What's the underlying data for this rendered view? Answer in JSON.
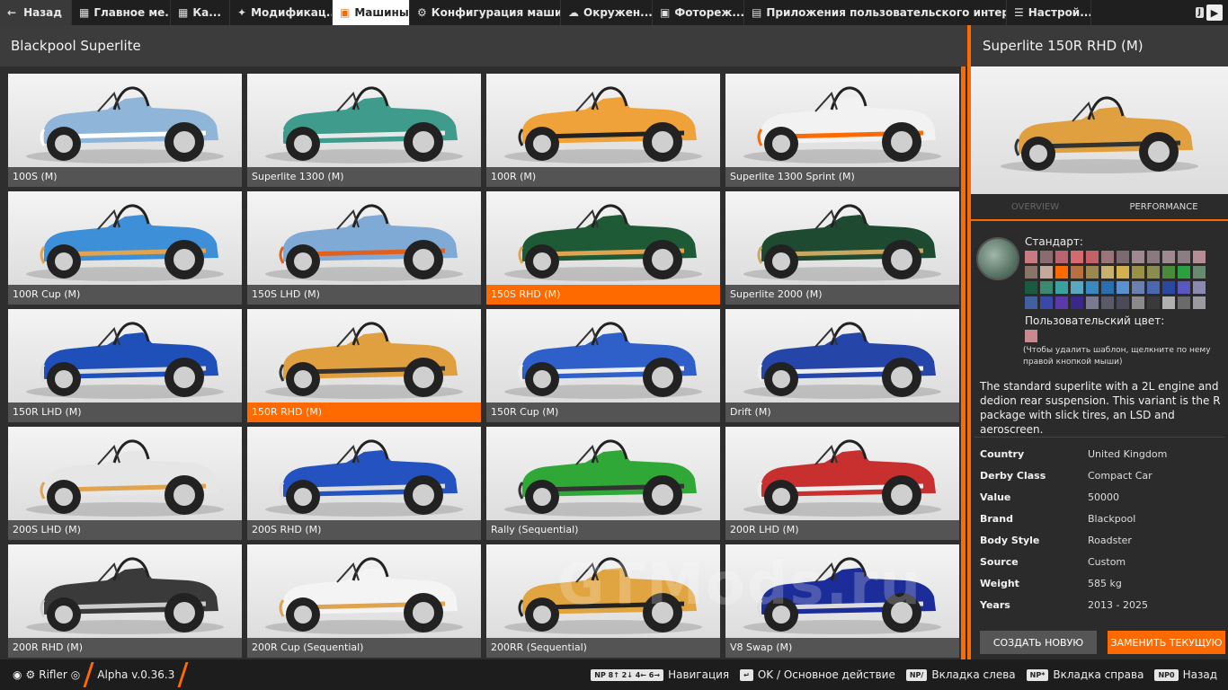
{
  "colors": {
    "accent": "#ff6a00"
  },
  "topbar": {
    "back_label": "Назад",
    "tabs": [
      {
        "label": "Главное ме...",
        "icon": "grid-icon"
      },
      {
        "label": "Ка...",
        "icon": "map-icon"
      },
      {
        "label": "Модификац...",
        "icon": "puzzle-icon"
      },
      {
        "label": "Машины",
        "icon": "car-icon"
      },
      {
        "label": "Конфигурация маши...",
        "icon": "engine-icon"
      },
      {
        "label": "Окружен...",
        "icon": "weather-icon"
      },
      {
        "label": "Фотореж...",
        "icon": "camera-icon"
      },
      {
        "label": "Приложения пользовательского интерфе...",
        "icon": "window-icon"
      },
      {
        "label": "Настрой...",
        "icon": "sliders-icon"
      }
    ],
    "key_hint": "J"
  },
  "header": {
    "title": "Blackpool Superlite"
  },
  "cars": [
    {
      "name": "100S (M)",
      "body": "#8fb6d8",
      "accent": "#ffffff"
    },
    {
      "name": "Superlite 1300 (M)",
      "body": "#3f9b8c",
      "accent": "#e8e8e8"
    },
    {
      "name": "100R (M)",
      "body": "#f0a23a",
      "accent": "#222222"
    },
    {
      "name": "Superlite 1300 Sprint (M)",
      "body": "#f2f2f2",
      "accent": "#ff6a00"
    },
    {
      "name": "100R Cup (M)",
      "body": "#3d8fd8",
      "accent": "#e0a450"
    },
    {
      "name": "150S LHD (M)",
      "body": "#7faad6",
      "accent": "#e06020"
    },
    {
      "name": "150S RHD (M)",
      "body": "#1e5a36",
      "accent": "#e0a450"
    },
    {
      "name": "Superlite 2000 (M)",
      "body": "#1d4a30",
      "accent": "#c8a860"
    },
    {
      "name": "150R LHD (M)",
      "body": "#1f4fb8",
      "accent": "#dddddd"
    },
    {
      "name": "150R RHD (M)",
      "body": "#e0a040",
      "accent": "#333333"
    },
    {
      "name": "150R Cup (M)",
      "body": "#2f5fc8",
      "accent": "#eeeeee"
    },
    {
      "name": "Drift (M)",
      "body": "#2545a8",
      "accent": "#eeeeee"
    },
    {
      "name": "200S LHD (M)",
      "body": "#e6e6e6",
      "accent": "#e0a450"
    },
    {
      "name": "200S RHD (M)",
      "body": "#2452c0",
      "accent": "#dddddd"
    },
    {
      "name": "Rally (Sequential)",
      "body": "#2fa838",
      "accent": "#333333"
    },
    {
      "name": "200R LHD (M)",
      "body": "#c83030",
      "accent": "#eeeeee"
    },
    {
      "name": "200R RHD (M)",
      "body": "#3a3a3a",
      "accent": "#cccccc"
    },
    {
      "name": "200R Cup (Sequential)",
      "body": "#f4f4f4",
      "accent": "#e0a450"
    },
    {
      "name": "200RR (Sequential)",
      "body": "#e0a440",
      "accent": "#222222"
    },
    {
      "name": "V8 Swap (M)",
      "body": "#1c2c98",
      "accent": "#dddddd"
    }
  ],
  "selected_cars": [
    "150S RHD (M)",
    "150R RHD (M)"
  ],
  "watermark": "GTMods.ru",
  "detail": {
    "title": "Superlite 150R RHD (M)",
    "preview": {
      "body": "#e0a040",
      "accent": "#333333"
    },
    "tabs": [
      "OVERVIEW",
      "PERFORMANCE"
    ],
    "standard_label": "Стандарт:",
    "palette": [
      "#c97a80",
      "#8a6c70",
      "#b86570",
      "#d46a6f",
      "#c46068",
      "#9a7478",
      "#7c6a70",
      "#a08890",
      "#8a7a80",
      "#9e8a8e",
      "#8a7e82",
      "#b48e94",
      "#8a7468",
      "#c4a89a",
      "#ff6a00",
      "#b87040",
      "#9a8850",
      "#c8b070",
      "#d2b050",
      "#9a9048",
      "#8a8c50",
      "#4a8a3a",
      "#2aa040",
      "#6a8a70",
      "#1a5a40",
      "#3a8a70",
      "#3aa0a0",
      "#5aa8c0",
      "#3a88c0",
      "#2a70b0",
      "#5a90d0",
      "#6a80b0",
      "#4a68b0",
      "#2a48a0",
      "#5a58c0",
      "#8a8ab0",
      "#4060a0",
      "#3a48a8",
      "#5a3aa8",
      "#3a2888",
      "#7a7a90",
      "#5a5a6a",
      "#4a4a5a",
      "#8a8a8a",
      "#3a3a3a",
      "#b0b0b0",
      "#6a6a6a",
      "#9a9aa0"
    ],
    "custom_label": "Пользовательский цвет:",
    "custom_hint": "(Чтобы удалить шаблон, щелкните по нему правой кнопкой мыши)",
    "description": "The standard superlite with a 2L engine and dedion rear suspension. This variant is the R package with slick tires, an LSD and aeroscreen.",
    "specs": [
      {
        "k": "Country",
        "v": "United Kingdom"
      },
      {
        "k": "Derby Class",
        "v": "Compact Car"
      },
      {
        "k": "Value",
        "v": "50000"
      },
      {
        "k": "Brand",
        "v": "Blackpool"
      },
      {
        "k": "Body Style",
        "v": "Roadster"
      },
      {
        "k": "Source",
        "v": "Custom"
      },
      {
        "k": "Weight",
        "v": "585 kg"
      },
      {
        "k": "Years",
        "v": "2013 - 2025"
      }
    ],
    "btn_new": "СОЗДАТЬ НОВУЮ",
    "btn_replace": "ЗАМЕНИТЬ ТЕКУЩУЮ"
  },
  "bottombar": {
    "user": "Rifler",
    "version": "Alpha v.0.36.3",
    "hints": [
      {
        "key": "NP 8↑ 2↓ 4← 6→",
        "label": "Навигация"
      },
      {
        "key": "↵",
        "label": "OK / Основное действие"
      },
      {
        "key": "NP/",
        "label": "Вкладка слева"
      },
      {
        "key": "NP*",
        "label": "Вкладка справа"
      },
      {
        "key": "NP0",
        "label": "Назад"
      }
    ]
  }
}
